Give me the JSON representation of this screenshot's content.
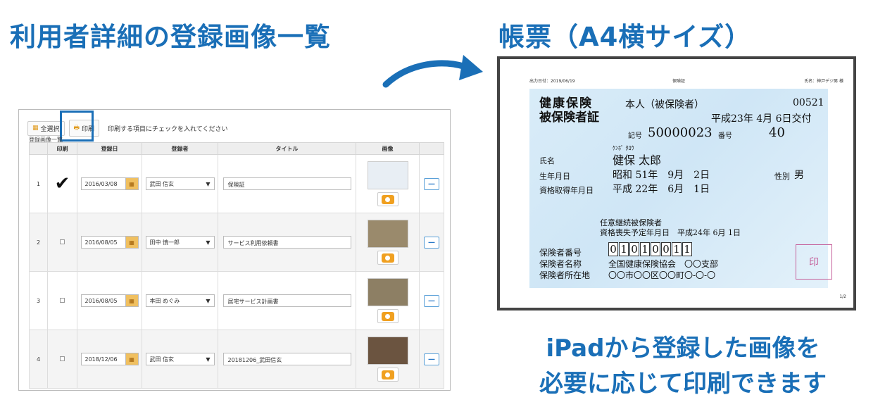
{
  "headings": {
    "left": "利用者詳細の登録画像一覧",
    "right": "帳票（A4横サイズ）"
  },
  "caption": {
    "line1": "iPadから登録した画像を",
    "line2": "必要に応じて印刷できます"
  },
  "toolbar": {
    "select_all_label": "全選択",
    "print_label": "印刷",
    "hint": "印刷する項目にチェックを入れてください"
  },
  "section_title": "登録画像一覧",
  "table": {
    "headers": [
      "印刷",
      "登録日",
      "登録者",
      "タイトル",
      "画像"
    ],
    "rows": [
      {
        "no": "1",
        "checked": true,
        "date": "2016/03/08",
        "user": "武田 信玄",
        "title": "保険証"
      },
      {
        "no": "2",
        "checked": false,
        "date": "2016/08/05",
        "user": "田中 慎一郎",
        "title": "サービス利用依頼書"
      },
      {
        "no": "3",
        "checked": false,
        "date": "2016/08/05",
        "user": "本田 めぐみ",
        "title": "居宅サービス計画書"
      },
      {
        "no": "4",
        "checked": false,
        "date": "2018/12/06",
        "user": "武田 信玄",
        "title": "20181206_武田信玄"
      }
    ]
  },
  "document": {
    "output_date": "出力日付：2019/06/19",
    "doc_title": "保険証",
    "recipient": "氏名：神戸デジ男 様",
    "page": "1/2",
    "card": {
      "title1": "健康保険",
      "title2": "被保険者証",
      "type": "本人（被保険者）",
      "code": "00521",
      "issued": "平成23年 4月 6日交付",
      "kigo_label": "記号",
      "kigo": "50000023",
      "bango_label": "番号",
      "bango": "40",
      "furigana": "ｹﾝﾎﾟ ﾀﾛｳ",
      "name_label": "氏名",
      "name": "健保 太郎",
      "birth_label": "生年月日",
      "birth": "昭和 51年　9月　2日",
      "sex_label": "性別",
      "sex": "男",
      "acq_label": "資格取得年月日",
      "acq": "平成 22年　6月　1日",
      "cont1": "任意継続被保険者",
      "cont2": "資格喪失予定年月日　平成24年 6月 1日",
      "insurer_no_label": "保険者番号",
      "insurer_no": [
        "0",
        "1",
        "0",
        "1",
        "0",
        "0",
        "1",
        "1"
      ],
      "insurer_name_label": "保険者名称",
      "insurer_name": "全国健康保険協会　〇〇支部",
      "insurer_addr_label": "保険者所在地",
      "insurer_addr": "〇〇市〇〇区〇〇町〇-〇-〇",
      "stamp": "印"
    }
  },
  "colors": {
    "accent": "#1a6fb7",
    "stamp": "#c5609a"
  }
}
